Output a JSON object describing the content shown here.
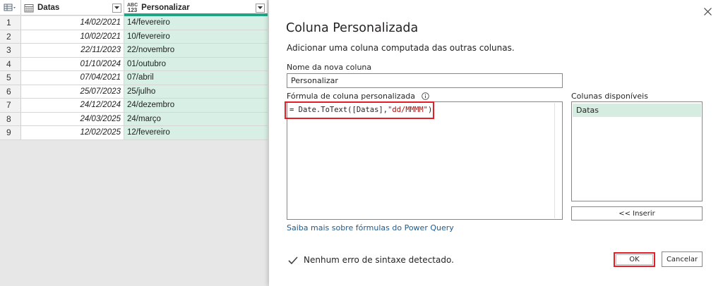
{
  "grid": {
    "columns": [
      {
        "name": "Datas",
        "type_icon": "calendar-icon"
      },
      {
        "name": "Personalizar",
        "type_icon_top": "ABC",
        "type_icon_bottom": "123"
      }
    ],
    "rows": [
      {
        "index": "1",
        "date": "14/02/2021",
        "text": "14/fevereiro"
      },
      {
        "index": "2",
        "date": "10/02/2021",
        "text": "10/fevereiro"
      },
      {
        "index": "3",
        "date": "22/11/2023",
        "text": "22/novembro"
      },
      {
        "index": "4",
        "date": "01/10/2024",
        "text": "01/outubro"
      },
      {
        "index": "5",
        "date": "07/04/2021",
        "text": "07/abril"
      },
      {
        "index": "6",
        "date": "25/07/2023",
        "text": "25/julho"
      },
      {
        "index": "7",
        "date": "24/12/2024",
        "text": "24/dezembro"
      },
      {
        "index": "8",
        "date": "24/03/2025",
        "text": "24/março"
      },
      {
        "index": "9",
        "date": "12/02/2025",
        "text": "12/fevereiro"
      }
    ]
  },
  "dialog": {
    "title": "Coluna Personalizada",
    "subtitle": "Adicionar uma coluna computada das outras colunas.",
    "name_label": "Nome da nova coluna",
    "name_value": "Personalizar",
    "formula_label": "Fórmula de coluna personalizada",
    "formula_prefix": "= Date.ToText([Datas],",
    "formula_string": "\"dd/MMMM\"",
    "formula_suffix": ")",
    "available_label": "Colunas disponíveis",
    "available_columns": [
      "Datas"
    ],
    "insert_label": "<< Inserir",
    "learn_link": "Saiba mais sobre fórmulas do Power Query",
    "status_text": "Nenhum erro de sintaxe detectado.",
    "ok_label": "OK",
    "cancel_label": "Cancelar"
  },
  "colors": {
    "selected_column": "#d7efe4",
    "selected_bar": "#1fa586",
    "highlight": "#e41e26",
    "link": "#205a8a"
  }
}
